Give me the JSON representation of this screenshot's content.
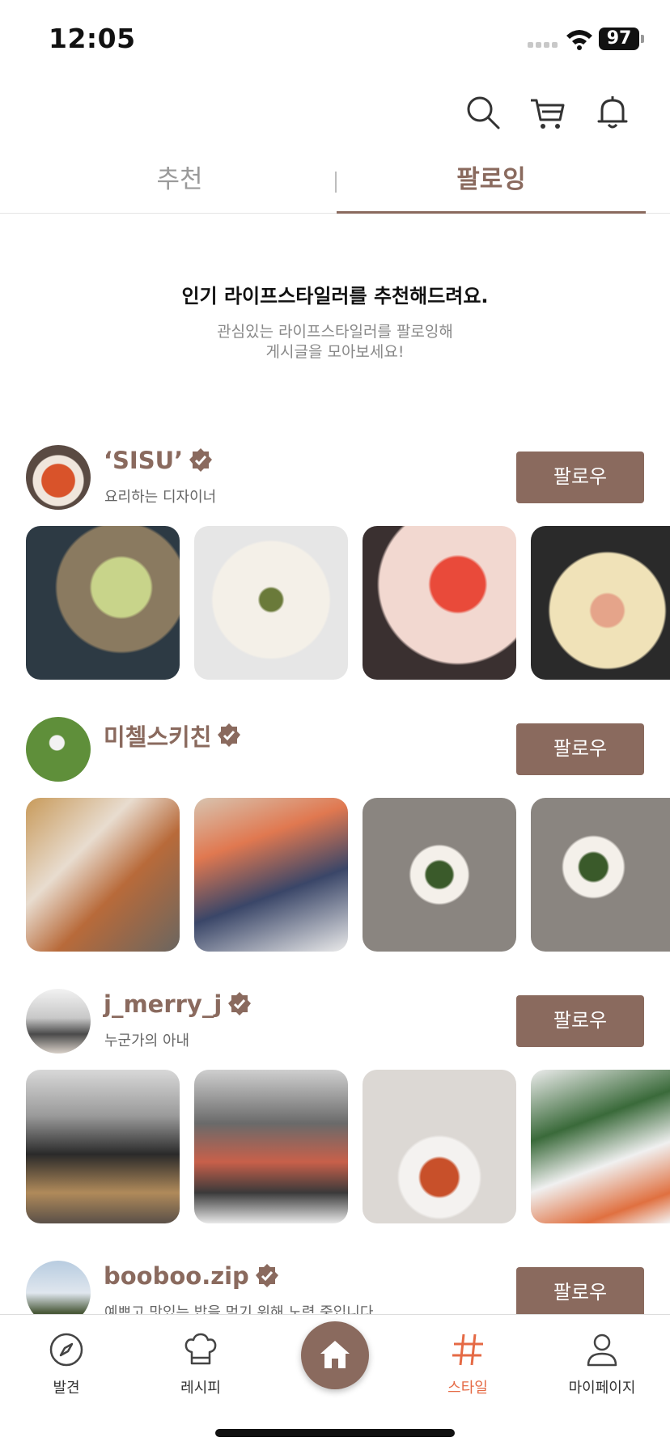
{
  "status_bar": {
    "time": "12:05",
    "battery": "97"
  },
  "header": {
    "icons": [
      "search-icon",
      "cart-icon",
      "bell-icon"
    ]
  },
  "tabs": [
    {
      "label": "추천",
      "active": false
    },
    {
      "label": "팔로잉",
      "active": true
    }
  ],
  "intro": {
    "title": "인기 라이프스타일러를 추천해드려요.",
    "subtitle_line1": "관심있는 라이프스타일러를 팔로잉해",
    "subtitle_line2": "게시글을 모아보세요!"
  },
  "follow_label": "팔로우",
  "creators": [
    {
      "name": "‘SISU’",
      "description": "요리하는 디자이너",
      "verified": true
    },
    {
      "name": "미첼스키친",
      "description": "",
      "verified": true
    },
    {
      "name": "j_merry_j",
      "description": "누군가의 아내",
      "verified": true
    },
    {
      "name": "booboo.zip",
      "description": "예쁘고 맛있는 밥을 먹기 위해 노력 중입니다",
      "verified": true
    }
  ],
  "tabbar": [
    {
      "label": "발견",
      "icon": "compass-icon",
      "active": false
    },
    {
      "label": "레시피",
      "icon": "chef-hat-icon",
      "active": false
    },
    {
      "label": "",
      "icon": "home-icon",
      "active": false
    },
    {
      "label": "스타일",
      "icon": "hashtag-icon",
      "active": true
    },
    {
      "label": "마이페이지",
      "icon": "person-icon",
      "active": false
    }
  ],
  "colors": {
    "brand": "#8a6a5e",
    "accent": "#e56a45"
  }
}
